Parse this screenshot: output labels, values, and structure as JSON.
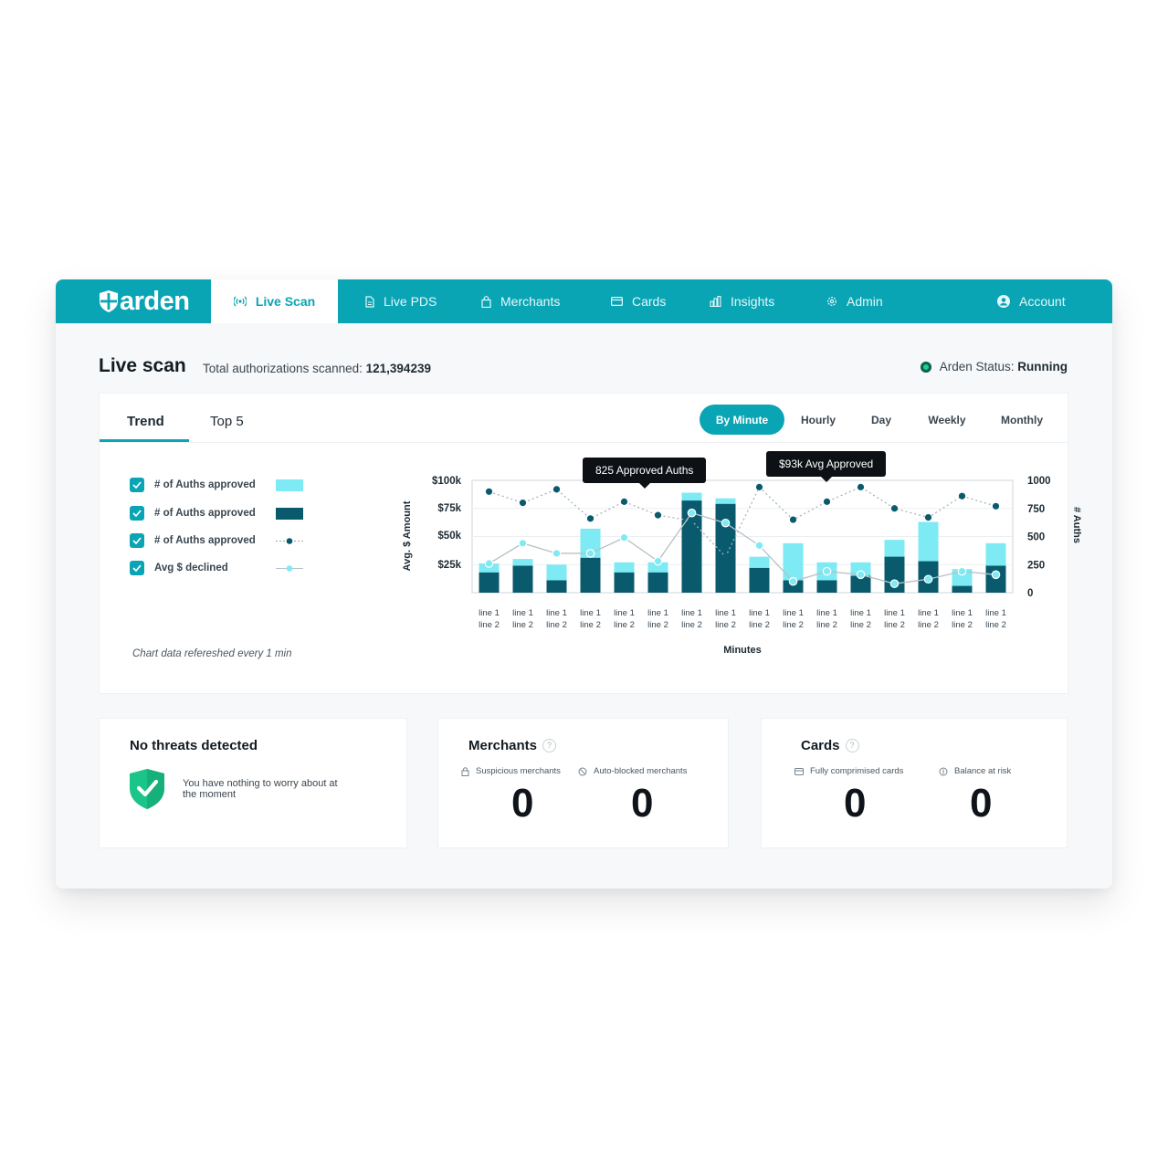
{
  "brand": {
    "name": "arden"
  },
  "nav": {
    "active": {
      "label": "Live Scan",
      "icon": "broadcast-icon"
    },
    "items": [
      {
        "label": "Live PDS",
        "icon": "document-icon"
      },
      {
        "label": "Merchants",
        "icon": "bag-icon"
      },
      {
        "label": "Cards",
        "icon": "card-icon"
      },
      {
        "label": "Insights",
        "icon": "bar-chart-icon"
      },
      {
        "label": "Admin",
        "icon": "gear-icon"
      }
    ],
    "account": {
      "label": "Account",
      "icon": "user-avatar-icon"
    }
  },
  "header": {
    "title": "Live scan",
    "total_label": "Total authorizations scanned:",
    "total_value": "121,394239",
    "status_label": "Arden Status:",
    "status_value": "Running"
  },
  "tabs": [
    "Trend",
    "Top 5"
  ],
  "ranges": [
    "By Minute",
    "Hourly",
    "Day",
    "Weekly",
    "Monthly"
  ],
  "active_range": "By Minute",
  "legend": [
    {
      "label": "# of Auths approved",
      "swatch": "bar-light"
    },
    {
      "label": "# of Auths approved",
      "swatch": "bar-dark"
    },
    {
      "label": "# of Auths approved",
      "swatch": "line-dark"
    },
    {
      "label": "Avg $ declined",
      "swatch": "line-light"
    }
  ],
  "refresh_note": "Chart data refereshed every 1 min",
  "colors": {
    "accent": "#0aa5b5",
    "bar_light": "#7eeaf3",
    "bar_dark": "#0a5a6e",
    "status_green": "#1ed483"
  },
  "chart_data": {
    "type": "bar",
    "xlabel": "Minutes",
    "ylabel_left": "Avg. $ Amount",
    "ylabel_right": "# Auths",
    "yticks_left": [
      "$100k",
      "$75k",
      "$50k",
      "$25k"
    ],
    "yticks_right": [
      "1000",
      "750",
      "500",
      "250",
      "0"
    ],
    "ylim_right": [
      0,
      1000
    ],
    "grid": true,
    "categories": [
      [
        "line 1",
        "line 2"
      ],
      [
        "line 1",
        "line 2"
      ],
      [
        "line 1",
        "line 2"
      ],
      [
        "line 1",
        "line 2"
      ],
      [
        "line 1",
        "line 2"
      ],
      [
        "line 1",
        "line 2"
      ],
      [
        "line 1",
        "line 2"
      ],
      [
        "line 1",
        "line 2"
      ],
      [
        "line 1",
        "line 2"
      ],
      [
        "line 1",
        "line 2"
      ],
      [
        "line 1",
        "line 2"
      ],
      [
        "line 1",
        "line 2"
      ],
      [
        "line 1",
        "line 2"
      ],
      [
        "line 1",
        "line 2"
      ],
      [
        "line 1",
        "line 2"
      ],
      [
        "line 1",
        "line 2"
      ]
    ],
    "series": [
      {
        "values": [
          260,
          300,
          250,
          570,
          270,
          270,
          890,
          840,
          320,
          440,
          270,
          270,
          470,
          630,
          210,
          440
        ]
      },
      {
        "values": [
          180,
          240,
          110,
          310,
          180,
          180,
          820,
          790,
          220,
          110,
          110,
          150,
          320,
          280,
          60,
          240
        ]
      },
      {
        "values": [
          900,
          800,
          920,
          660,
          810,
          690,
          640,
          320,
          940,
          650,
          810,
          940,
          750,
          670,
          860,
          770
        ]
      },
      {
        "values": [
          260,
          440,
          350,
          350,
          490,
          280,
          710,
          620,
          420,
          100,
          190,
          160,
          80,
          120,
          190,
          160
        ]
      }
    ],
    "tooltips": [
      {
        "text": "825 Approved Auths",
        "index": 6
      },
      {
        "text": "$93k Avg Approved",
        "index": 11
      }
    ]
  },
  "cards": {
    "threats": {
      "title": "No threats detected",
      "message": "You have nothing to worry about at the moment"
    },
    "merchants": {
      "title": "Merchants",
      "items": [
        {
          "label": "Suspicious merchants",
          "value": "0",
          "icon": "lock-icon"
        },
        {
          "label": "Auto-blocked merchants",
          "value": "0",
          "icon": "blocked-icon"
        }
      ]
    },
    "cards": {
      "title": "Cards",
      "items": [
        {
          "label": "Fully comprimised cards",
          "value": "0",
          "icon": "card-icon"
        },
        {
          "label": "Balance at risk",
          "value": "0",
          "icon": "coin-icon"
        }
      ]
    }
  }
}
